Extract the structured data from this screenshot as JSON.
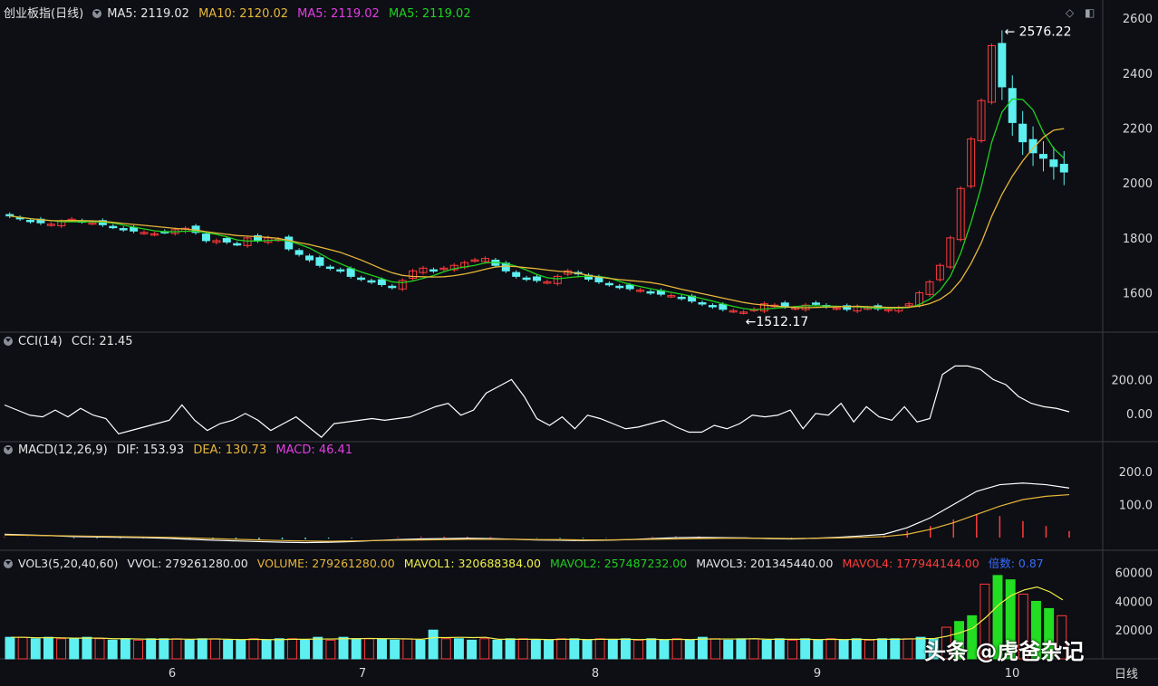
{
  "header": {
    "main_title": "创业板指(日线)",
    "ma5a": "MA5: 2119.02",
    "ma10": "MA10: 2120.02",
    "ma5b": "MA5: 2119.02",
    "ma5c": "MA5: 2119.02",
    "cci_title": "CCI(14)",
    "cci_val": "CCI: 21.45",
    "macd_title": "MACD(12,26,9)",
    "macd_dif": "DIF: 153.93",
    "macd_dea": "DEA: 130.73",
    "macd_val": "MACD: 46.41",
    "vol_title": "VOL3(5,20,40,60)",
    "vvol": "VVOL: 279261280.00",
    "volume": "VOLUME: 279261280.00",
    "mavol1": "MAVOL1: 320688384.00",
    "mavol2": "MAVOL2: 257487232.00",
    "mavol3": "MAVOL3: 201345440.00",
    "mavol4": "MAVOL4: 177944144.00",
    "beishu": "倍数: 0.87"
  },
  "annotations": {
    "high": "2576.22",
    "low": "1512.17"
  },
  "footer": {
    "period_label": "日线",
    "watermark": "头条 @虎爸杂记"
  },
  "colors": {
    "up": "#ff3b3b",
    "down": "#5ef0f0",
    "ma5": "#1fd11f",
    "ma10": "#e8b63a",
    "white": "#ffffff",
    "magenta": "#e43ce4",
    "vol_green": "#22dd22"
  },
  "chart_data": [
    {
      "type": "candlestick",
      "title": "创业板指(日线)",
      "x_ticks": [
        "6",
        "7",
        "8",
        "9",
        "10"
      ],
      "yticks": [
        1600,
        1800,
        2000,
        2200,
        2400,
        2600
      ],
      "ylim": [
        1480,
        2620
      ],
      "high": 2576.22,
      "low": 1512.17,
      "close_series": [
        1880,
        1870,
        1860,
        1855,
        1850,
        1860,
        1868,
        1860,
        1855,
        1848,
        1840,
        1830,
        1825,
        1820,
        1815,
        1822,
        1830,
        1835,
        1820,
        1790,
        1790,
        1785,
        1778,
        1800,
        1790,
        1800,
        1795,
        1760,
        1740,
        1720,
        1700,
        1690,
        1680,
        1660,
        1650,
        1640,
        1630,
        1620,
        1645,
        1680,
        1690,
        1680,
        1690,
        1700,
        1710,
        1720,
        1725,
        1700,
        1680,
        1660,
        1650,
        1645,
        1640,
        1660,
        1680,
        1670,
        1650,
        1640,
        1630,
        1620,
        1615,
        1610,
        1600,
        1595,
        1590,
        1580,
        1570,
        1560,
        1550,
        1540,
        1535,
        1530,
        1540,
        1560,
        1555,
        1550,
        1545,
        1555,
        1560,
        1550,
        1545,
        1540,
        1550,
        1545,
        1542,
        1540,
        1545,
        1560,
        1600,
        1640,
        1700,
        1800,
        1980,
        2160,
        2300,
        2500,
        2350,
        2220,
        2150,
        2110,
        2090,
        2060,
        2040
      ]
    },
    {
      "type": "line",
      "title": "CCI(14)",
      "yticks": [
        0.0,
        200.0
      ],
      "ylim": [
        -150,
        330
      ],
      "values": [
        50,
        20,
        -10,
        -20,
        20,
        -20,
        30,
        -10,
        -30,
        -120,
        -100,
        -80,
        -60,
        -40,
        50,
        -40,
        -100,
        -60,
        -40,
        0,
        -40,
        -100,
        -60,
        -20,
        -80,
        -140,
        -60,
        -50,
        -40,
        -30,
        -40,
        -30,
        -20,
        10,
        40,
        60,
        -10,
        20,
        120,
        160,
        200,
        100,
        -30,
        -70,
        -20,
        -90,
        -10,
        -30,
        -60,
        -90,
        -80,
        -60,
        -40,
        -80,
        -110,
        -110,
        -70,
        -90,
        -60,
        -10,
        -20,
        -10,
        20,
        -90,
        0,
        -10,
        60,
        -50,
        40,
        -20,
        -40,
        40,
        -50,
        -30,
        230,
        280,
        280,
        260,
        200,
        170,
        100,
        60,
        40,
        30,
        10
      ]
    },
    {
      "type": "line",
      "title": "MACD(12,26,9)",
      "yticks": [
        100.0,
        200.0
      ],
      "ylim": [
        -30,
        230
      ],
      "dif": [
        10,
        8,
        6,
        3,
        2,
        1,
        0,
        -2,
        -5,
        -8,
        -10,
        -12,
        -14,
        -15,
        -14,
        -12,
        -9,
        -6,
        -4,
        -3,
        -2,
        -3,
        -5,
        -7,
        -8,
        -9,
        -8,
        -6,
        -3,
        0,
        1,
        0,
        -1,
        -3,
        -4,
        -2,
        1,
        5,
        10,
        30,
        60,
        100,
        140,
        160,
        165,
        160,
        150
      ],
      "dea": [
        8,
        7,
        6,
        5,
        4,
        3,
        2,
        1,
        -1,
        -3,
        -5,
        -7,
        -9,
        -10,
        -11,
        -10,
        -9,
        -8,
        -7,
        -6,
        -5,
        -5,
        -5,
        -6,
        -6,
        -7,
        -7,
        -6,
        -5,
        -4,
        -3,
        -2,
        -2,
        -2,
        -3,
        -2,
        -1,
        1,
        3,
        10,
        25,
        45,
        70,
        95,
        115,
        125,
        130
      ],
      "hist": [
        2,
        1,
        0,
        -2,
        -2,
        -2,
        -2,
        -3,
        -4,
        -5,
        -5,
        -5,
        -5,
        -5,
        -3,
        -2,
        0,
        2,
        3,
        3,
        3,
        2,
        0,
        -1,
        -2,
        -2,
        -1,
        0,
        2,
        4,
        4,
        2,
        1,
        -1,
        -1,
        0,
        2,
        4,
        7,
        20,
        35,
        55,
        70,
        65,
        50,
        35,
        20
      ]
    },
    {
      "type": "bar",
      "title": "VOL3(5,20,40,60)",
      "yticks": [
        20000,
        40000,
        60000
      ],
      "ylim": [
        0,
        68000
      ],
      "values": [
        15000,
        15000,
        14000,
        15000,
        14000,
        14000,
        15000,
        14000,
        13000,
        14000,
        13000,
        14000,
        14000,
        14000,
        13000,
        14000,
        14000,
        13000,
        13000,
        14000,
        13000,
        14000,
        14000,
        13000,
        15000,
        13000,
        15000,
        14000,
        14000,
        14000,
        13000,
        14000,
        13000,
        20000,
        14000,
        14000,
        13000,
        14000,
        13000,
        14000,
        14000,
        13000,
        13000,
        14000,
        14000,
        13000,
        14000,
        13000,
        14000,
        13000,
        14000,
        13000,
        14000,
        13000,
        15000,
        14000,
        13000,
        14000,
        14000,
        13000,
        14000,
        13000,
        14000,
        13000,
        14000,
        13000,
        14000,
        13000,
        14000,
        14000,
        14000,
        15000,
        14000,
        22000,
        26000,
        30000,
        52000,
        58000,
        55000,
        45000,
        40000,
        35000,
        30000
      ]
    }
  ]
}
